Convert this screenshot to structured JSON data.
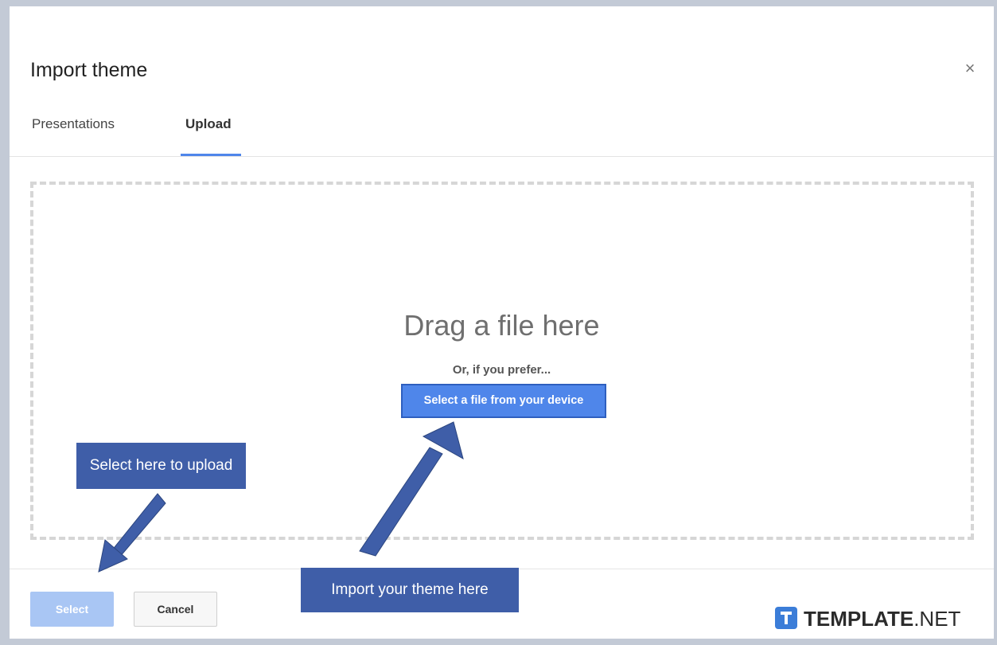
{
  "dialog": {
    "title": "Import theme",
    "close_glyph": "×"
  },
  "tabs": [
    {
      "label": "Presentations",
      "active": false
    },
    {
      "label": "Upload",
      "active": true
    }
  ],
  "dropzone": {
    "headline": "Drag a file here",
    "subtext": "Or, if you prefer...",
    "select_device_label": "Select a file from your device"
  },
  "footer": {
    "select_label": "Select",
    "select_enabled": false,
    "cancel_label": "Cancel"
  },
  "annotations": {
    "upload_callout": "Select here to upload",
    "theme_callout": "Import your theme here"
  },
  "branding": {
    "logo_icon": "T",
    "logo_name": "TEMPLATE",
    "logo_suffix": ".NET"
  },
  "colors": {
    "accent": "#4f86ea",
    "callout": "#3f5ea8",
    "disabled_button": "#a9c6f4"
  }
}
